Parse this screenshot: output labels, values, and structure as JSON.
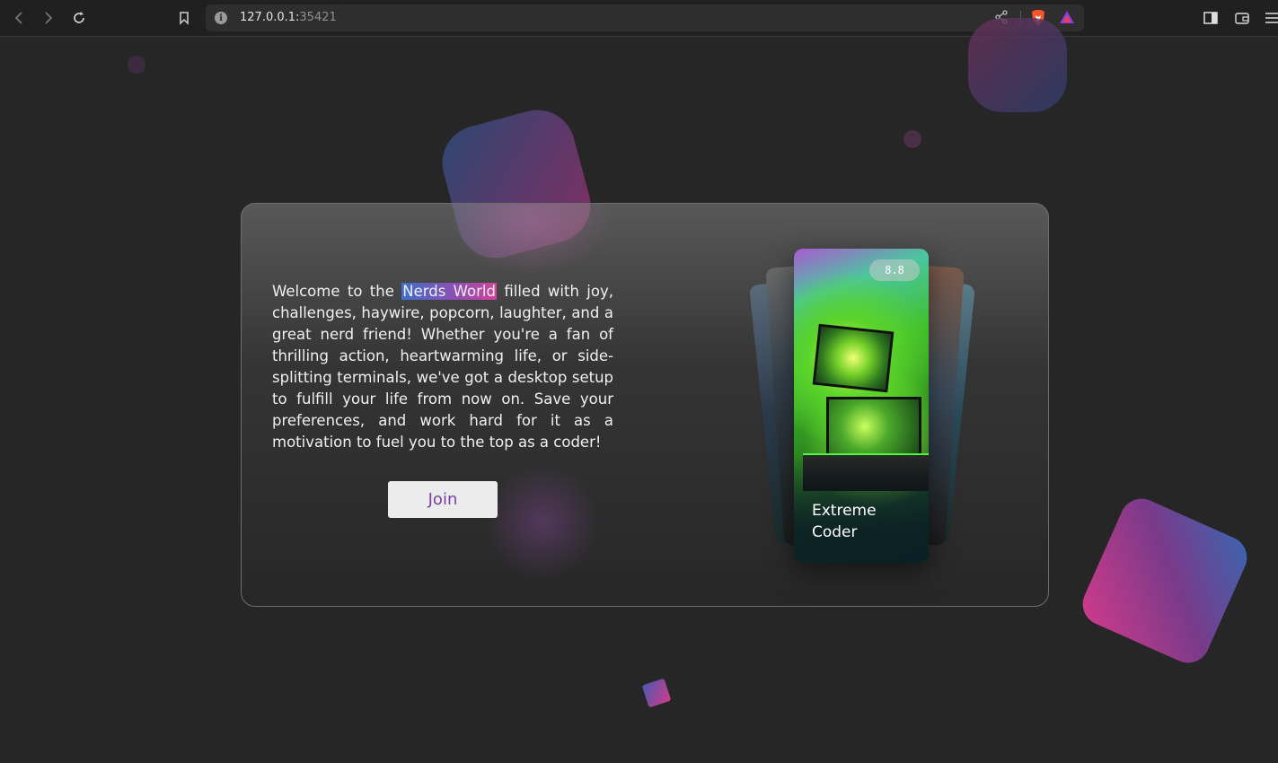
{
  "browser": {
    "url_host": "127.0.0.1:",
    "url_port": "35421"
  },
  "intro": {
    "before": "Welcome to the ",
    "highlight": "Nerds World",
    "after": " filled with joy, challenges, haywire, popcorn, laughter, and a great nerd friend! Whether you're a fan of thrilling action, heartwarming life, or side-splitting terminals, we've got a desktop setup to fulfill your life from now on. Save your preferences, and work hard for it as a motivation to fuel you to the top as a coder!"
  },
  "join_label": "Join",
  "feature_card": {
    "rating": "8.8",
    "title": "Extreme\nCoder"
  },
  "colors": {
    "accent_purple": "#7a3fa6",
    "highlight_start": "#3f6fc9",
    "highlight_end": "#d0449a"
  }
}
